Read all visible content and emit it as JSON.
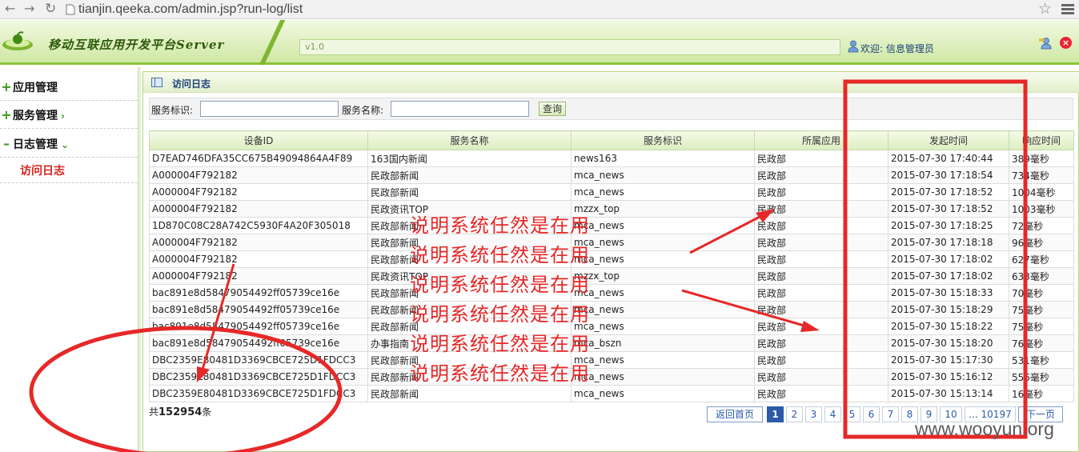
{
  "browser": {
    "url": "tianjin.qeeka.com/admin.jsp?run-log/list",
    "back_icon": "back-arrow-icon",
    "forward_icon": "forward-arrow-icon",
    "reload_icon": "reload-icon"
  },
  "header": {
    "title": "移动互联应用开发平台Server",
    "version": "v1.0",
    "welcome": "欢迎: 信息管理员"
  },
  "sidebar": {
    "items": [
      {
        "label": "应用管理",
        "state": "+"
      },
      {
        "label": "服务管理",
        "state": "+"
      },
      {
        "label": "日志管理",
        "state": "-"
      }
    ],
    "active_sub": "访问日志"
  },
  "panel": {
    "title": "访问日志"
  },
  "search": {
    "service_id_label": "服务标识:",
    "service_name_label": "服务名称:",
    "submit_label": "查询",
    "service_id_value": "",
    "service_name_value": ""
  },
  "table": {
    "columns": [
      "设备ID",
      "服务名称",
      "服务标识",
      "所属应用",
      "发起时间",
      "响应时间"
    ],
    "rows": [
      [
        "D7EAD746DFA35CC675B49094864A4F89",
        "163国内新闻",
        "news163",
        "民政部",
        "2015-07-30 17:40:44",
        "389毫秒"
      ],
      [
        "A000004F792182",
        "民政部新闻",
        "mca_news",
        "民政部",
        "2015-07-30 17:18:54",
        "734毫秒"
      ],
      [
        "A000004F792182",
        "民政部新闻",
        "mca_news",
        "民政部",
        "2015-07-30 17:18:52",
        "1004毫秒"
      ],
      [
        "A000004F792182",
        "民政资讯TOP",
        "mzzx_top",
        "民政部",
        "2015-07-30 17:18:52",
        "1003毫秒"
      ],
      [
        "1D870C08C28A742C5930F4A20F305018",
        "民政部新闻",
        "mca_news",
        "民政部",
        "2015-07-30 17:18:25",
        "72毫秒"
      ],
      [
        "A000004F792182",
        "民政部新闻",
        "mca_news",
        "民政部",
        "2015-07-30 17:18:18",
        "96毫秒"
      ],
      [
        "A000004F792182",
        "民政部新闻",
        "mca_news",
        "民政部",
        "2015-07-30 17:18:02",
        "627毫秒"
      ],
      [
        "A000004F792182",
        "民政资讯TOP",
        "mzzx_top",
        "民政部",
        "2015-07-30 17:18:02",
        "633毫秒"
      ],
      [
        "bac891e8d58479054492ff05739ce16e",
        "民政部新闻",
        "mca_news",
        "民政部",
        "2015-07-30 15:18:33",
        "70毫秒"
      ],
      [
        "bac891e8d58479054492ff05739ce16e",
        "民政部新闻",
        "mca_news",
        "民政部",
        "2015-07-30 15:18:29",
        "75毫秒"
      ],
      [
        "bac891e8d58479054492ff05739ce16e",
        "民政部新闻",
        "mca_news",
        "民政部",
        "2015-07-30 15:18:22",
        "75毫秒"
      ],
      [
        "bac891e8d58479054492ff05739ce16e",
        "办事指南",
        "mca_bszn",
        "民政部",
        "2015-07-30 15:18:20",
        "76毫秒"
      ],
      [
        "DBC2359E80481D3369CBCE725D1FDCC3",
        "民政部新闻",
        "mca_news",
        "民政部",
        "2015-07-30 15:17:30",
        "531毫秒"
      ],
      [
        "DBC2359E80481D3369CBCE725D1FDCC3",
        "民政部新闻",
        "mca_news",
        "民政部",
        "2015-07-30 15:16:12",
        "556毫秒"
      ],
      [
        "DBC2359E80481D3369CBCE725D1FDCC3",
        "民政部新闻",
        "mca_news",
        "民政部",
        "2015-07-30 15:13:14",
        "16毫秒"
      ]
    ]
  },
  "total": {
    "prefix": "共",
    "count": "152954",
    "suffix": "条"
  },
  "pager": {
    "first_label": "返回首页",
    "pages": [
      "1",
      "2",
      "3",
      "4",
      "5",
      "6",
      "7",
      "8",
      "9",
      "10",
      "... 10197"
    ],
    "current": "1",
    "next_label": "下一页"
  },
  "annotation": {
    "text": "说明系统任然是在用",
    "repeat": 6,
    "color": "#e62828"
  },
  "watermark": "www.wooyun.org"
}
